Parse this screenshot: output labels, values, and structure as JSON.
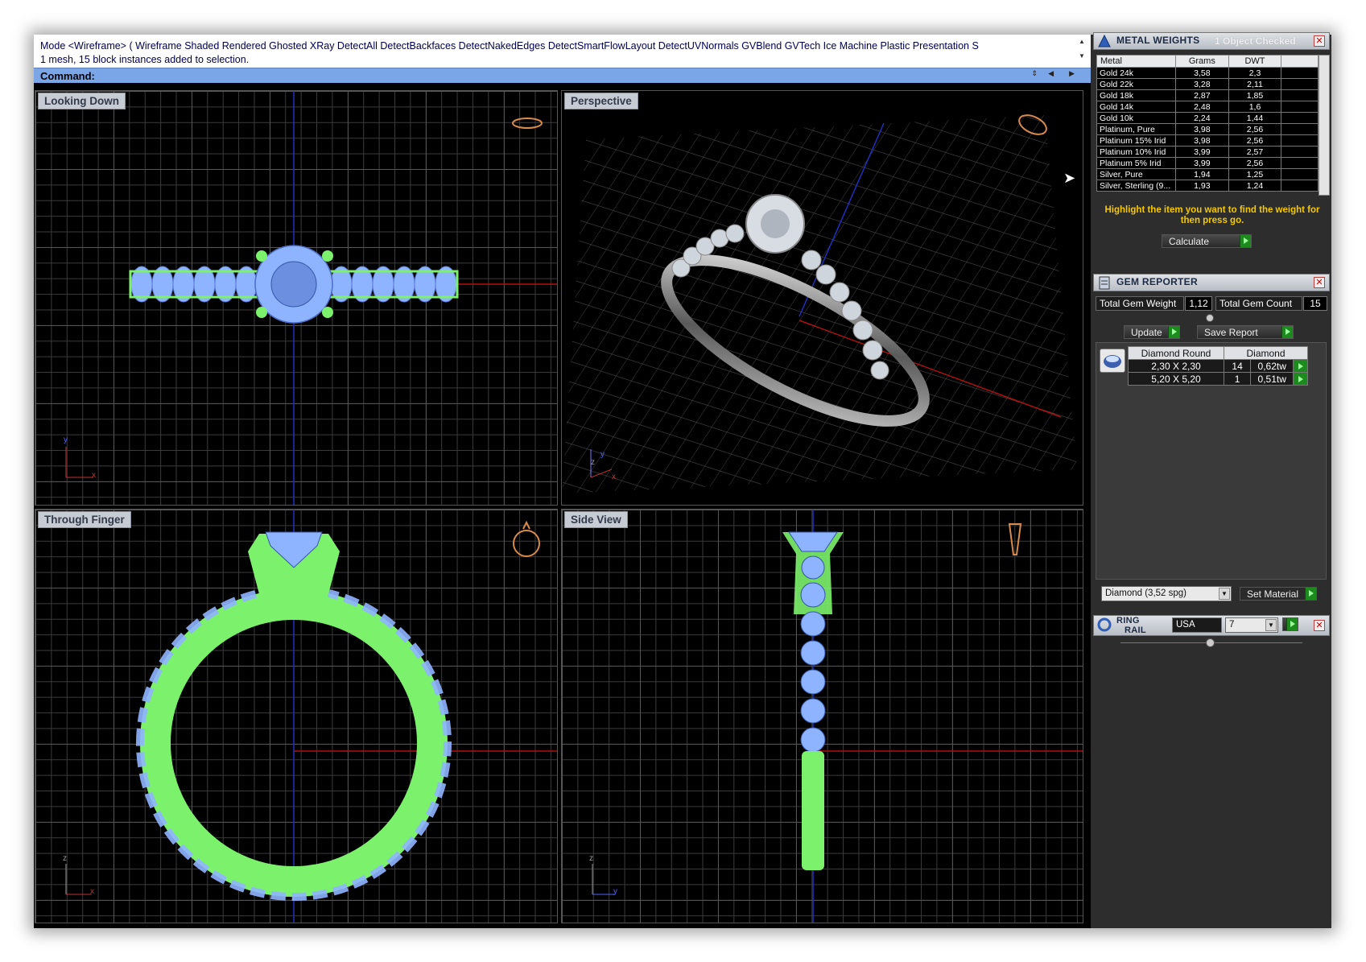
{
  "command_area": {
    "line1": "Mode <Wireframe> ( Wireframe  Shaded  Rendered  Ghosted  XRay  DetectAll  DetectBackfaces  DetectNakedEdges  DetectSmartFlowLayout  DetectUVNormals  GVBlend  GVTech  Ice  Machine  Plastic  Presentation  S",
    "line2": "1 mesh, 15 block instances added to selection.",
    "prompt": "Command:"
  },
  "viewports": {
    "top_left": {
      "title": "Looking Down",
      "axis_a": "y",
      "axis_b": "x"
    },
    "top_right": {
      "title": "Perspective",
      "axis_a": "z",
      "axis_b": "y",
      "axis_c": "x"
    },
    "bottom_left": {
      "title": "Through Finger",
      "axis_a": "z",
      "axis_b": "x"
    },
    "bottom_right": {
      "title": "Side View",
      "axis_a": "z",
      "axis_b": "y"
    }
  },
  "metal_weights": {
    "title": "METAL WEIGHTS",
    "subtitle": "1 Object Checked",
    "columns": [
      "Metal",
      "Grams",
      "DWT"
    ],
    "rows": [
      [
        "Gold 24k",
        "3,58",
        "2,3"
      ],
      [
        "Gold 22k",
        "3,28",
        "2,11"
      ],
      [
        "Gold 18k",
        "2,87",
        "1,85"
      ],
      [
        "Gold 14k",
        "2,48",
        "1,6"
      ],
      [
        "Gold 10k",
        "2,24",
        "1,44"
      ],
      [
        "Platinum, Pure",
        "3,98",
        "2,56"
      ],
      [
        "Platinum 15% Irid",
        "3,98",
        "2,56"
      ],
      [
        "Platinum 10% Irid",
        "3,99",
        "2,57"
      ],
      [
        "Platinum 5% Irid",
        "3,99",
        "2,56"
      ],
      [
        "Silver, Pure",
        "1,94",
        "1,25"
      ],
      [
        "Silver, Sterling (9...",
        "1,93",
        "1,24"
      ]
    ],
    "hint": "Highlight the item you want to find the weight for then press go.",
    "calculate_label": "Calculate"
  },
  "gem_reporter": {
    "title": "GEM REPORTER",
    "total_weight_label": "Total Gem Weight",
    "total_weight": "1,12",
    "total_count_label": "Total Gem Count",
    "total_count": "15",
    "update_label": "Update",
    "save_report_label": "Save Report",
    "table_headers": [
      "Diamond Round",
      "Diamond"
    ],
    "rows": [
      {
        "size": "2,30 X 2,30",
        "count": "14",
        "weight": "0,62tw"
      },
      {
        "size": "5,20 X 5,20",
        "count": "1",
        "weight": "0,51tw"
      }
    ],
    "material_select": "Diamond   (3,52 spg)",
    "set_material_label": "Set Material"
  },
  "ring_rail": {
    "title_line1": "RING",
    "title_line2": "RAIL",
    "region": "USA",
    "size": "7"
  },
  "colors": {
    "wire_green": "#7cf26c",
    "wire_blue": "#8fb4ff",
    "axis_red": "#b01010",
    "axis_blue": "#2030c0",
    "hint_yellow": "#f6c800"
  }
}
